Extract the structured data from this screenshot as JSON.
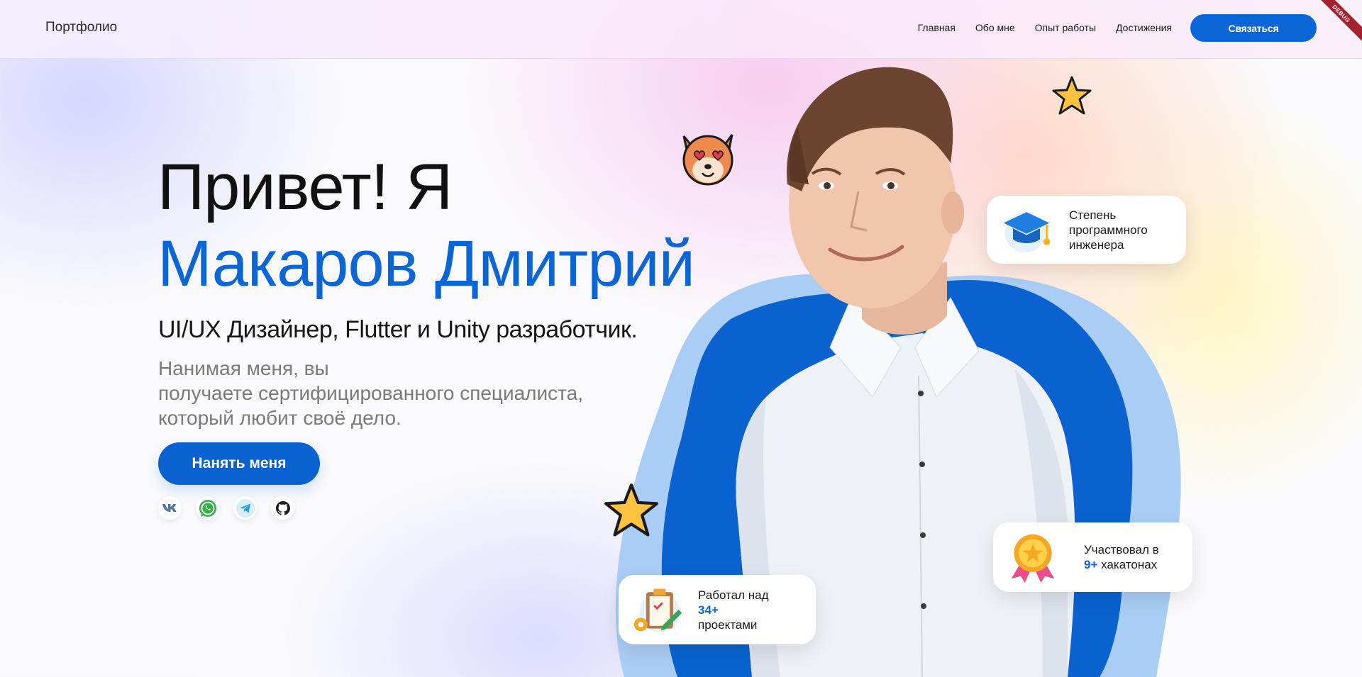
{
  "brand": "Портфолио",
  "nav": {
    "links": [
      "Главная",
      "Обо мне",
      "Опыт работы",
      "Достижения"
    ],
    "cta": "Связаться"
  },
  "debug_label": "DEBUG",
  "hero": {
    "greeting": "Привет! Я",
    "name": "Макаров Дмитрий",
    "role": "UI/UX Дизайнер, Flutter и Unity разработчик.",
    "desc_line1": "Нанимая меня, вы",
    "desc_line2": "получаете сертифицированного специалиста,",
    "desc_line3": "который любит своё дело.",
    "hire_button": "Нанять меня"
  },
  "socials": [
    "vk-icon",
    "whatsapp-icon",
    "telegram-icon",
    "github-icon"
  ],
  "cards": {
    "degree": {
      "line1": "Степень",
      "line2": "программного",
      "line3": "инженера"
    },
    "hackathons": {
      "prefix": "Участвовал в",
      "number": "9+",
      "suffix": "хакатонах"
    },
    "projects": {
      "prefix": "Работал над",
      "number": "34+",
      "suffix": "проектами"
    }
  },
  "colors": {
    "accent": "#0a66d6",
    "blob_light": "#a9cdf4"
  }
}
